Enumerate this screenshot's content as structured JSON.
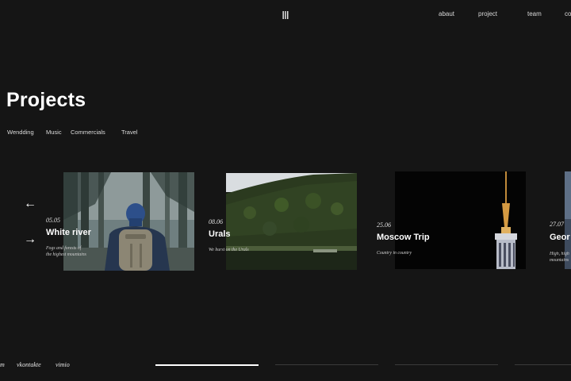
{
  "nav": {
    "items": [
      {
        "label": "abaut"
      },
      {
        "label": "project"
      },
      {
        "label": "team"
      },
      {
        "label": "co"
      }
    ]
  },
  "page": {
    "title": "Projects"
  },
  "filters": [
    "Wendding",
    "Music",
    "Commercials",
    "Travel"
  ],
  "arrows": {
    "prev": "←",
    "next": "→"
  },
  "cards": [
    {
      "date": "05.05",
      "title": "White river",
      "description": "Fogs and forests of the highest mountains"
    },
    {
      "date": "08.06",
      "title": "Urals",
      "description": "We burst on the Urals"
    },
    {
      "date": "25.06",
      "title": "Moscow Trip",
      "description": "Country in country"
    },
    {
      "date": "27.07",
      "title": "Geor",
      "description": "High, high mountains"
    }
  ],
  "social": [
    "m",
    "vkontakte",
    "vimio"
  ],
  "colors": {
    "background": "#151515",
    "text": "#ffffff",
    "progress_active": "#ffffff",
    "progress_inactive": "#3a3a3a"
  }
}
